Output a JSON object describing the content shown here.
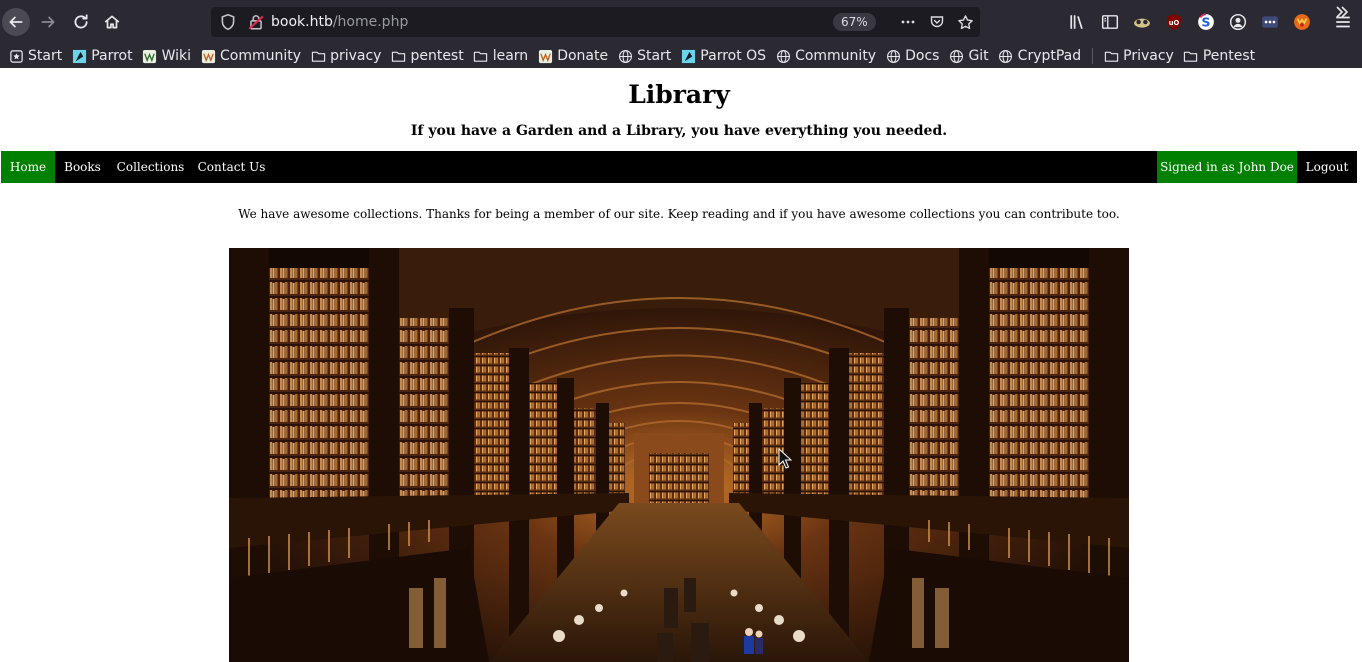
{
  "browser": {
    "url_host": "book.htb",
    "url_path": "/home.php",
    "zoom": "67%"
  },
  "bookmarks": [
    {
      "label": "Start",
      "icon": "start-icon"
    },
    {
      "label": "Parrot",
      "icon": "parrot-icon"
    },
    {
      "label": "Wiki",
      "icon": "wiki-icon"
    },
    {
      "label": "Community",
      "icon": "community-icon"
    },
    {
      "label": "privacy",
      "icon": "folder-icon"
    },
    {
      "label": "pentest",
      "icon": "folder-icon"
    },
    {
      "label": "learn",
      "icon": "folder-icon"
    },
    {
      "label": "Donate",
      "icon": "donate-icon"
    },
    {
      "label": "Start",
      "icon": "globe-icon"
    },
    {
      "label": "Parrot OS",
      "icon": "parrot-icon"
    },
    {
      "label": "Community",
      "icon": "globe-icon"
    },
    {
      "label": "Docs",
      "icon": "globe-icon"
    },
    {
      "label": "Git",
      "icon": "globe-icon"
    },
    {
      "label": "CryptPad",
      "icon": "globe-icon"
    },
    {
      "label": "Privacy",
      "icon": "folder-icon"
    },
    {
      "label": "Pentest",
      "icon": "folder-icon"
    }
  ],
  "site": {
    "title": "Library",
    "tagline": "If you have a Garden and a Library, you have everything you needed.",
    "intro": "We have awesome collections. Thanks for being a member of our site. Keep reading and if you have awesome collections you can contribute too."
  },
  "nav": {
    "home": "Home",
    "books": "Books",
    "collections": "Collections",
    "contact": "Contact Us",
    "signed_in": "Signed in as John Doe",
    "logout": "Logout"
  },
  "colors": {
    "nav_background": "#000000",
    "nav_active": "#008000",
    "chrome": "#2b2a33"
  }
}
